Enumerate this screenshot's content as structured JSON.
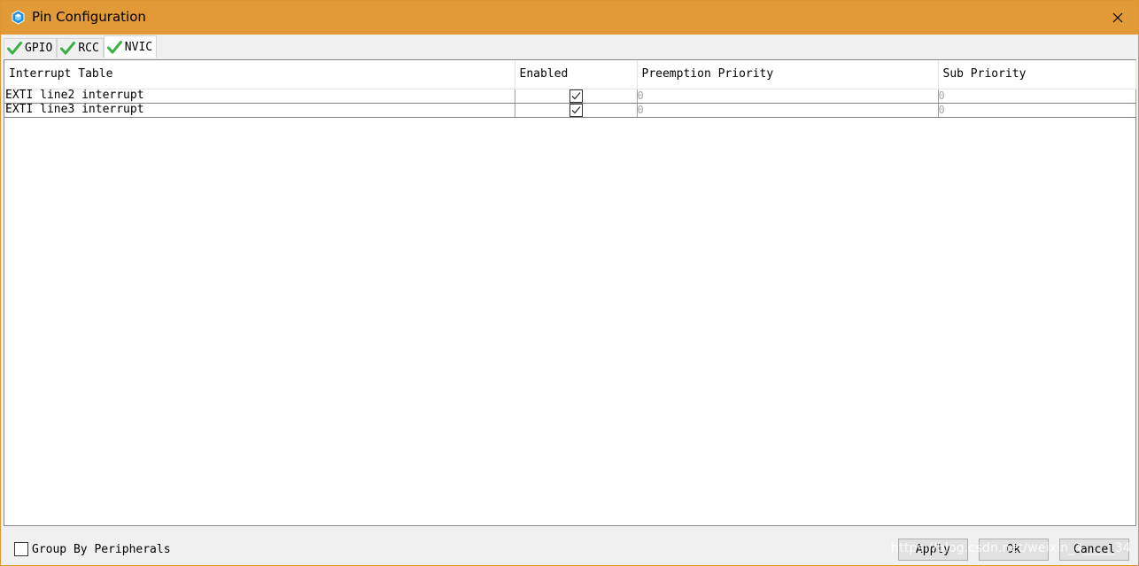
{
  "window": {
    "title": "Pin Configuration",
    "title_bar_color": "#e29a36"
  },
  "tabs": [
    {
      "label": "GPIO",
      "icon": "green-check-icon",
      "active": false
    },
    {
      "label": "RCC",
      "icon": "green-check-icon",
      "active": false
    },
    {
      "label": "NVIC",
      "icon": "green-check-icon",
      "active": true
    }
  ],
  "table": {
    "columns": [
      "Interrupt Table",
      "Enabled",
      "Preemption Priority",
      "Sub Priority"
    ],
    "rows": [
      {
        "name": "EXTI line2 interrupt",
        "enabled": true,
        "preemption": "0",
        "sub": "0"
      },
      {
        "name": "EXTI line3 interrupt",
        "enabled": true,
        "preemption": "0",
        "sub": "0"
      }
    ]
  },
  "footer": {
    "group_by_label": "Group By Peripherals",
    "group_by_checked": false,
    "apply_label": "Apply",
    "ok_label": "Ok",
    "cancel_label": "Cancel",
    "watermark": "https://blog.csdn.net/weixin_4_____34"
  }
}
